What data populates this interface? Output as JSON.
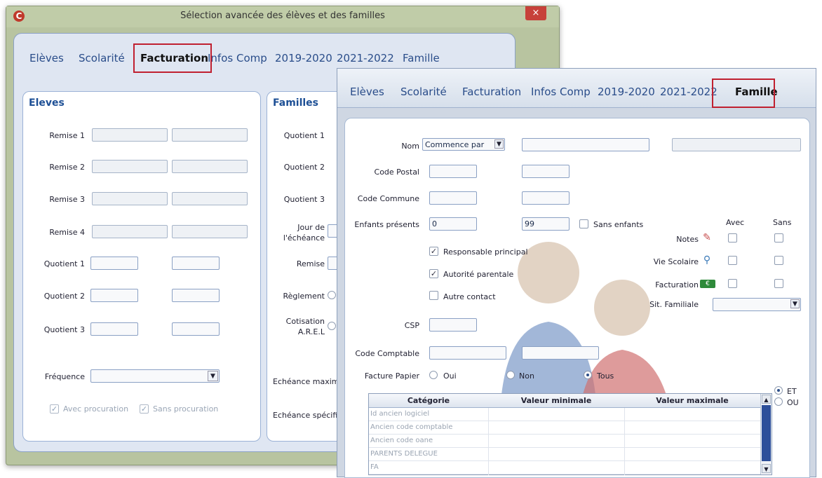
{
  "window_back": {
    "title": "Sélection avancée des élèves et des familles",
    "close": "×",
    "tabs": [
      "Elèves",
      "Scolarité",
      "Facturation",
      "Infos Comp",
      "2019-2020",
      "2021-2022",
      "Famille"
    ],
    "active_tab": "Facturation",
    "eleves": {
      "title": "Eleves",
      "remise1": "Remise 1",
      "remise2": "Remise 2",
      "remise3": "Remise 3",
      "remise4": "Remise 4",
      "quotient1": "Quotient 1",
      "quotient2": "Quotient 2",
      "quotient3": "Quotient 3",
      "frequence": "Fréquence",
      "avec_procuration": "Avec procuration",
      "sans_procuration": "Sans procuration"
    },
    "familles": {
      "title": "Familles",
      "quotient1": "Quotient 1",
      "quotient2": "Quotient 2",
      "quotient3": "Quotient 3",
      "jour_echeance_1": "Jour de",
      "jour_echeance_2": "l'échéance",
      "remise": "Remise",
      "reglement": "Règlement",
      "cotisation_1": "Cotisation",
      "cotisation_2": "A.R.E.L",
      "echeance_max": "Echéance maximur",
      "echeance_spec": "Echéance spécifiqu"
    }
  },
  "window_front": {
    "tabs": [
      "Elèves",
      "Scolarité",
      "Facturation",
      "Infos Comp",
      "2019-2020",
      "2021-2022",
      "Famille"
    ],
    "active_tab": "Famille",
    "nom_label": "Nom",
    "nom_select": "Commence par",
    "code_postal": "Code Postal",
    "code_commune": "Code Commune",
    "enfants_presents": "Enfants présents",
    "enfants_min": "0",
    "enfants_max": "99",
    "sans_enfants": "Sans enfants",
    "responsable_principal": "Responsable principal",
    "autorite_parentale": "Autorité parentale",
    "autre_contact": "Autre contact",
    "csp": "CSP",
    "code_comptable": "Code Comptable",
    "facture_papier": "Facture Papier",
    "oui": "Oui",
    "non": "Non",
    "tous": "Tous",
    "avec": "Avec",
    "sans": "Sans",
    "notes": "Notes",
    "vie_scolaire": "Vie Scolaire",
    "facturation": "Facturation",
    "sit_familiale": "Sit. Familiale",
    "et": "ET",
    "ou": "OU",
    "grid_headers": [
      "Catégorie",
      "Valeur minimale",
      "Valeur maximale"
    ],
    "grid_rows": [
      "Id ancien logiciel",
      "Ancien code comptable",
      "Ancien code oane",
      "PARENTS DELEGUE",
      "FA"
    ],
    "icons": {
      "notes": "notes-icon",
      "vie_scolaire": "magnifier-icon",
      "facturation": "money-icon"
    }
  }
}
